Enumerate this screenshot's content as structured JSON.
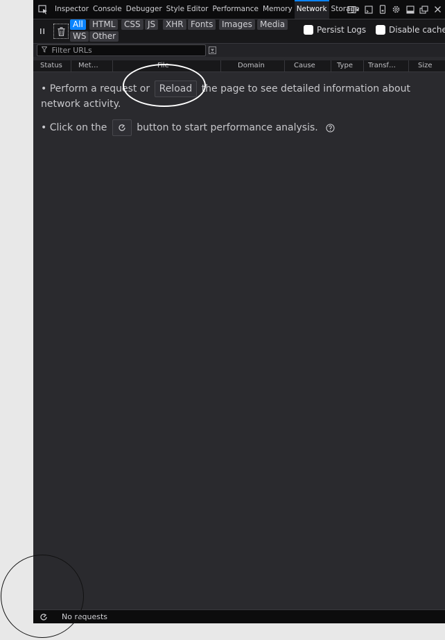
{
  "toolbox": {
    "tabs": [
      "Inspector",
      "Console",
      "Debugger",
      "Style Editor",
      "Performance",
      "Memory",
      "Network",
      "Storage"
    ],
    "selected_tab": "Network",
    "accent_color": "#0a84ff"
  },
  "network_toolbar": {
    "filters": [
      "All",
      "HTML",
      "CSS",
      "JS",
      "XHR",
      "Fonts",
      "Images",
      "Media",
      "WS",
      "Other"
    ],
    "active_filter": "All",
    "persist_logs_label": "Persist Logs",
    "disable_cache_label": "Disable cache"
  },
  "filter_urls": {
    "placeholder": "Filter URLs"
  },
  "columns": [
    "Status",
    "Met…",
    "File",
    "Domain",
    "Cause",
    "Type",
    "Transf…",
    "Size"
  ],
  "empty_state": {
    "line1_before": "• Perform a request or",
    "reload_button": "Reload",
    "line1_after": "the page to see detailed information about",
    "line1_cont": "network activity.",
    "line2_before": "• Click on the",
    "line2_after": "button to start performance analysis."
  },
  "status_bar": {
    "text": "No requests"
  },
  "icons": [
    "element-picker-icon",
    "pause-icon",
    "trash-icon",
    "filter-icon",
    "filter-options-icon",
    "performance-icon",
    "help-icon",
    "frame-select-icon",
    "split-console-icon",
    "responsive-mode-icon",
    "settings-icon",
    "dock-bottom-icon",
    "separate-window-icon",
    "close-icon"
  ]
}
